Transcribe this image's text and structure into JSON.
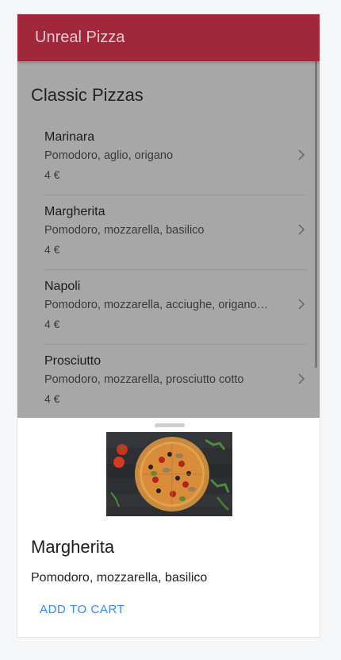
{
  "app": {
    "title": "Unreal Pizza"
  },
  "colors": {
    "app_bar": "#a1283a",
    "accent": "#3c86e6",
    "overlay": "#a7a7a7"
  },
  "section": {
    "title": "Classic Pizzas"
  },
  "pizzas": [
    {
      "name": "Marinara",
      "ingredients": "Pomodoro, aglio, origano",
      "price": "4 €"
    },
    {
      "name": "Margherita",
      "ingredients": "Pomodoro, mozzarella, basilico",
      "price": "4 €"
    },
    {
      "name": "Napoli",
      "ingredients": "Pomodoro, mozzarella, acciughe, origano…",
      "price": "4 €"
    },
    {
      "name": "Prosciutto",
      "ingredients": "Pomodoro, mozzarella, prosciutto cotto",
      "price": "4 €"
    }
  ],
  "sheet": {
    "image": "pizza-photo",
    "title": "Margherita",
    "description": "Pomodoro, mozzarella, basilico",
    "add_to_cart_label": "ADD TO CART"
  },
  "icons": {
    "chevron": "chevron-right-icon"
  }
}
